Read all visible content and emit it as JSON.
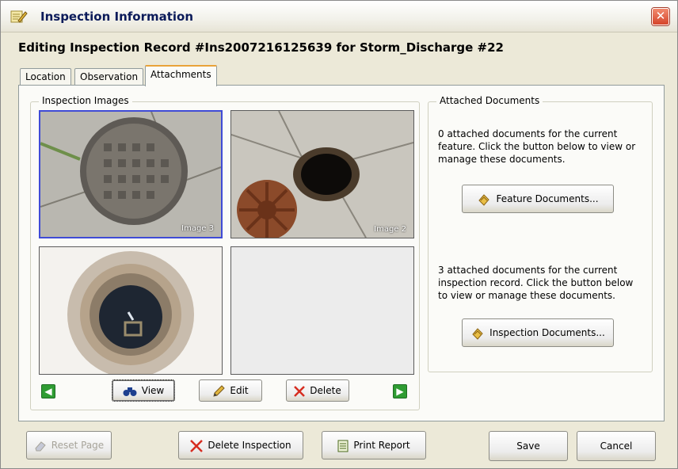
{
  "window": {
    "title": "Inspection Information",
    "close_glyph": "✕",
    "heading": "Editing Inspection Record #Ins2007216125639 for Storm_Discharge #22"
  },
  "tabs": [
    {
      "label": "Location",
      "active": false
    },
    {
      "label": "Observation",
      "active": false
    },
    {
      "label": "Attachments",
      "active": true
    }
  ],
  "images_group": {
    "label": "Inspection Images",
    "cells": [
      {
        "caption": "Image 3",
        "selected": true,
        "icon": "manhole-cover-image"
      },
      {
        "caption": "Image 2",
        "selected": false,
        "icon": "open-manhole-image"
      },
      {
        "caption": "",
        "selected": false,
        "icon": "manhole-shaft-image"
      },
      {
        "caption": "",
        "selected": false,
        "icon": "empty-slot"
      }
    ],
    "buttons": {
      "prev_glyph": "◀",
      "view": "View",
      "edit": "Edit",
      "delete": "Delete",
      "next_glyph": "▶"
    }
  },
  "documents_group": {
    "label": "Attached Documents",
    "feature_text": "0 attached documents for the current feature.  Click the button below to view or manage these documents.",
    "feature_button": "Feature Documents...",
    "inspection_text": "3 attached documents for the current inspection record.  Click the button below to view or manage these documents.",
    "inspection_button": "Inspection Documents..."
  },
  "footer": {
    "reset": "Reset Page",
    "delete_inspection": "Delete Inspection",
    "print": "Print Report",
    "save": "Save",
    "cancel": "Cancel"
  },
  "colors": {
    "title_text": "#0c1b5a",
    "close_red": "#d5442a",
    "selected_border": "#3f4bd6",
    "tab_highlight": "#e9a33a",
    "nav_green": "#2f9c33",
    "delete_x": "#d62d20"
  }
}
